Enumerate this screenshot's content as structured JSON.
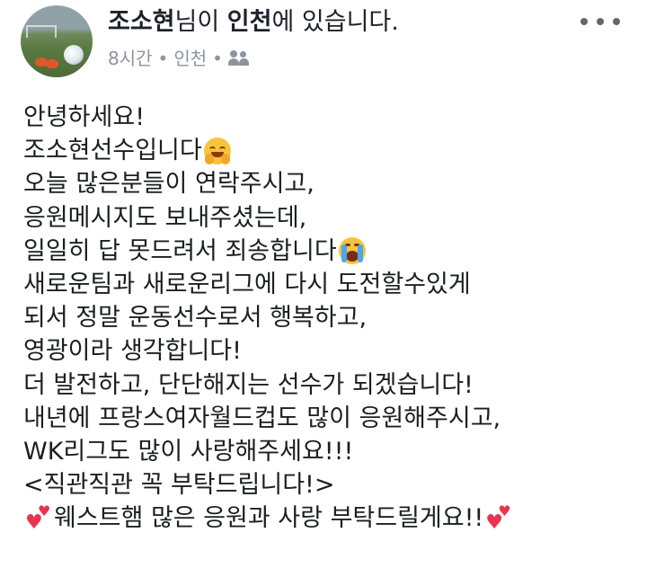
{
  "post": {
    "author": "조소현",
    "connector": "님이 ",
    "location": "인천",
    "suffix": "에 있습니다.",
    "time": "8시간",
    "place": "인천",
    "privacy_icon": "friends-icon",
    "more_icon": "more-horizontal-icon"
  },
  "body": {
    "lines": [
      "안녕하세요!",
      "조소현선수입니다",
      "오늘 많은분들이 연락주시고,",
      "응원메시지도 보내주셨는데,",
      "일일히 답 못드려서 죄송합니다",
      "새로운팀과 새로운리그에 다시 도전할수있게",
      "되서 정말 운동선수로서 행복하고,",
      "영광이라 생각합니다!",
      "더 발전하고, 단단해지는 선수가 되겠습니다!",
      "내년에 프랑스여자월드컵도 많이 응원해주시고,",
      "WK리그도 많이 사랑해주세요!!!",
      "<직관직관 꼭 부탁드립니다!>",
      "웨스트햄 많은 응원과 사랑 부탁드릴게요!!"
    ],
    "emoji": {
      "line1": "smiling-face-with-hands-emoji",
      "line4": "crying-face-emoji",
      "line12_start": "two-hearts-emoji",
      "line12_end": "two-hearts-emoji"
    }
  },
  "colors": {
    "text": "#1c1e21",
    "meta": "#8d949e",
    "heart": "#e8344e"
  }
}
